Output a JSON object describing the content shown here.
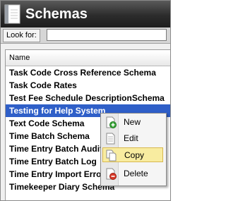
{
  "window": {
    "title": "Schemas"
  },
  "lookfor": {
    "label": "Look for:",
    "value": ""
  },
  "list": {
    "column_header": "Name",
    "rows": [
      "Task Code Cross Reference Schema",
      "Task Code Rates",
      "Test Fee Schedule DescriptionSchema",
      "Testing for Help System",
      "Text Code Schema",
      "Time Batch Schema",
      "Time Entry Batch Audit",
      "Time Entry Batch Log",
      "Time Entry Import Errors",
      "Timekeeper Diary Schema"
    ],
    "selected_index": 3
  },
  "context_menu": {
    "items": [
      {
        "label": "New",
        "icon": "new-document-icon"
      },
      {
        "label": "Edit",
        "icon": "edit-document-icon"
      },
      {
        "label": "Copy",
        "icon": "copy-document-icon"
      },
      {
        "label": "Delete",
        "icon": "delete-document-icon"
      }
    ],
    "hovered_index": 2
  },
  "colors": {
    "selection": "#2f5fc8",
    "menu_hover": "#f8eca0",
    "titlebar": "#2c2c2c"
  }
}
